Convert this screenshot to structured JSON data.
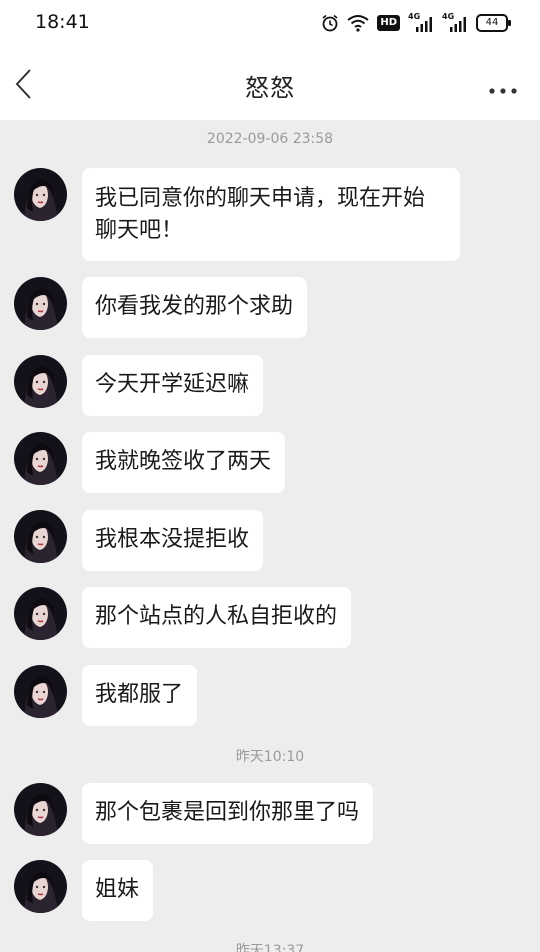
{
  "status_bar": {
    "time": "18:41",
    "icons": [
      "alarm-icon",
      "wifi-icon",
      "hd-icon",
      "signal-4g-icon",
      "signal-4g-icon",
      "battery-icon"
    ],
    "hd_label": "HD",
    "network_label_1": "4G",
    "network_label_2": "4G",
    "battery_level": "44"
  },
  "header": {
    "back_icon": "chevron-left-icon",
    "title": "怒怒",
    "more_icon": "more-dots-icon"
  },
  "timestamps": {
    "first": "2022-09-06 23:58",
    "second": "昨天10:10",
    "third": "昨天13:37"
  },
  "messages": [
    {
      "text": "我已同意你的聊天申请，现在开始聊天吧！"
    },
    {
      "text": "你看我发的那个求助"
    },
    {
      "text": "今天开学延迟嘛"
    },
    {
      "text": "我就晚签收了两天"
    },
    {
      "text": "我根本没提拒收"
    },
    {
      "text": "那个站点的人私自拒收的"
    },
    {
      "text": "我都服了"
    },
    {
      "text": "那个包裹是回到你那里了吗"
    },
    {
      "text": "姐妹"
    }
  ],
  "colors": {
    "background": "#ededed",
    "bubble": "#ffffff",
    "timestamp": "#9a9a9a"
  }
}
